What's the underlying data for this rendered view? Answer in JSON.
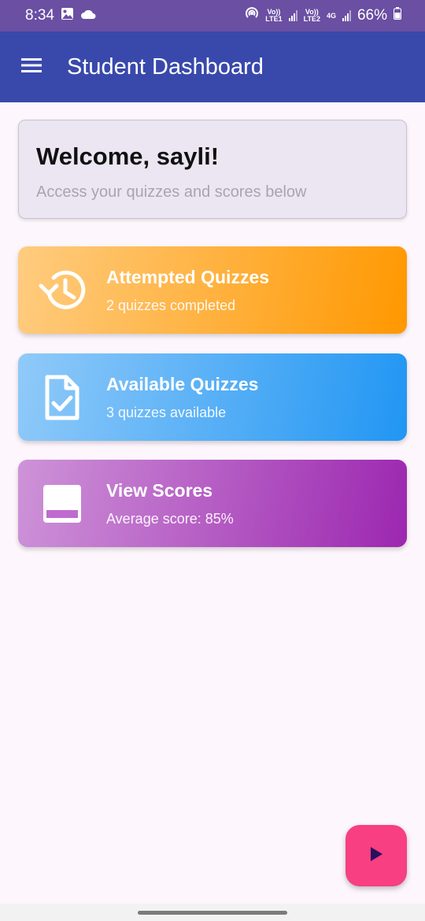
{
  "status_bar": {
    "time": "8:34",
    "sim1_top": "Vo))",
    "sim1_bottom": "LTE1",
    "sim2_top": "Vo))",
    "sim2_bottom": "LTE2",
    "network": "4G",
    "battery": "66%",
    "icons": [
      "image-icon",
      "cloud-icon",
      "hotspot-icon",
      "signal-icon",
      "battery-icon"
    ]
  },
  "app_bar": {
    "title": "Student Dashboard",
    "menu_icon": "menu-icon"
  },
  "welcome": {
    "title": "Welcome, sayli!",
    "subtitle": "Access your quizzes and scores below"
  },
  "tiles": [
    {
      "title": "Attempted Quizzes",
      "subtitle": "2 quizzes completed",
      "icon": "history-icon",
      "color": "#ff9800"
    },
    {
      "title": "Available Quizzes",
      "subtitle": "3 quizzes available",
      "icon": "assignment-check-icon",
      "color": "#2196f3"
    },
    {
      "title": "View Scores",
      "subtitle": "Average score: 85%",
      "icon": "scores-icon",
      "color": "#9c27b0"
    }
  ],
  "fab": {
    "icon": "play-icon",
    "color": "#f73f82"
  },
  "colors": {
    "app_bar": "#3949ab",
    "status_bar": "#6a4fa3",
    "background": "#fdf6fc"
  }
}
